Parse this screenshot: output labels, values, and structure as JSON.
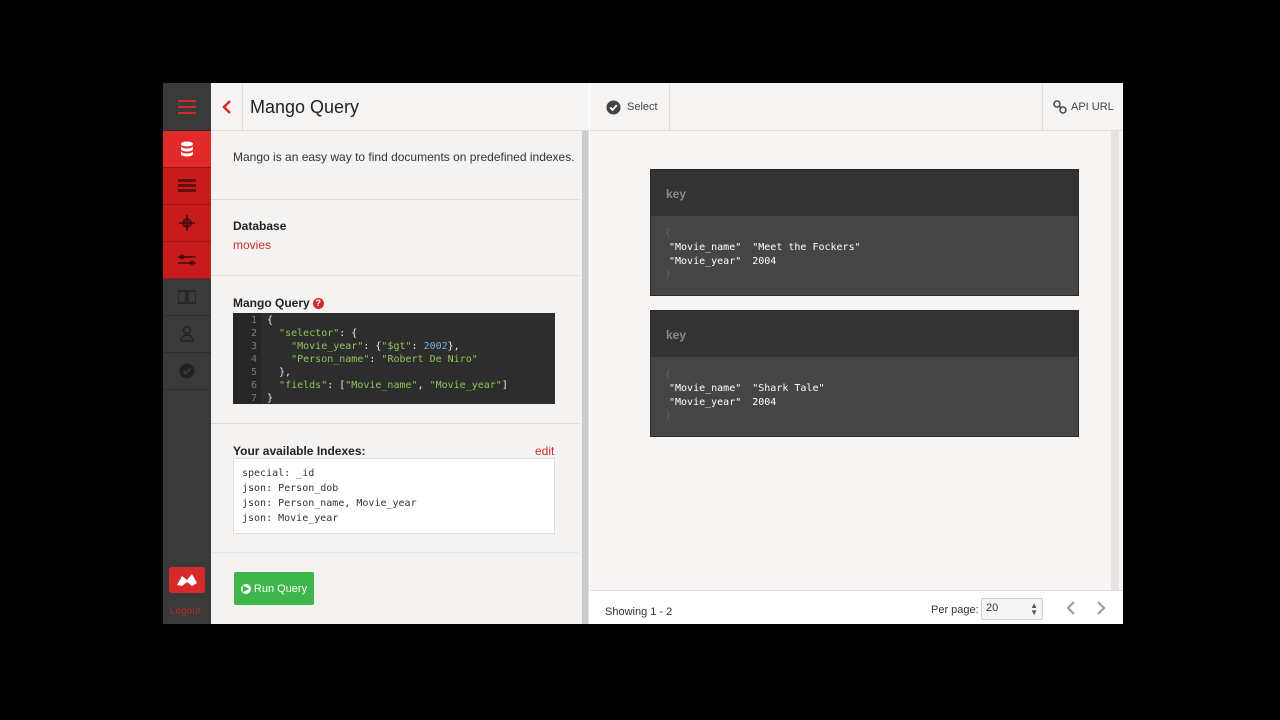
{
  "left": {
    "title": "Mango Query",
    "intro": "Mango is an easy way to find documents on predefined indexes.",
    "database_label": "Database",
    "database_name": "movies",
    "query_label": "Mango Query",
    "help": "?",
    "code_lines": [
      {
        "ln": "1",
        "parts": [
          {
            "c": "p",
            "t": "{"
          }
        ]
      },
      {
        "ln": "2",
        "parts": [
          {
            "c": "p",
            "t": "  "
          },
          {
            "c": "k",
            "t": "\"selector\""
          },
          {
            "c": "p",
            "t": ": {"
          }
        ]
      },
      {
        "ln": "3",
        "parts": [
          {
            "c": "p",
            "t": "    "
          },
          {
            "c": "k",
            "t": "\"Movie_year\""
          },
          {
            "c": "p",
            "t": ": {"
          },
          {
            "c": "k",
            "t": "\"$gt\""
          },
          {
            "c": "p",
            "t": ": "
          },
          {
            "c": "n",
            "t": "2002"
          },
          {
            "c": "p",
            "t": "},"
          }
        ]
      },
      {
        "ln": "4",
        "parts": [
          {
            "c": "p",
            "t": "    "
          },
          {
            "c": "k",
            "t": "\"Person_name\""
          },
          {
            "c": "p",
            "t": ": "
          },
          {
            "c": "s",
            "t": "\"Robert De Niro\""
          }
        ]
      },
      {
        "ln": "5",
        "parts": [
          {
            "c": "p",
            "t": "  },"
          }
        ]
      },
      {
        "ln": "6",
        "parts": [
          {
            "c": "p",
            "t": "  "
          },
          {
            "c": "k",
            "t": "\"fields\""
          },
          {
            "c": "p",
            "t": ": ["
          },
          {
            "c": "s",
            "t": "\"Movie_name\""
          },
          {
            "c": "p",
            "t": ", "
          },
          {
            "c": "s",
            "t": "\"Movie_year\""
          },
          {
            "c": "p",
            "t": "]"
          }
        ]
      },
      {
        "ln": "7",
        "parts": [
          {
            "c": "p",
            "t": "}"
          }
        ]
      }
    ],
    "indexes_label": "Your available Indexes:",
    "indexes_edit": "edit",
    "indexes": [
      "special: _id",
      "json: Person_dob",
      "json: Person_name, Movie_year",
      "json: Movie_year"
    ],
    "run_button": "Run Query"
  },
  "nav": {
    "logout": "Logout"
  },
  "right": {
    "select_label": "Select",
    "api_label": "API URL",
    "documents": [
      {
        "key": "key",
        "field1": "\"Movie_name\"",
        "value1": "\"Meet the Fockers\"",
        "field2": "\"Movie_year\"",
        "value2": "2004"
      },
      {
        "key": "key",
        "field1": "\"Movie_name\"",
        "value1": "\"Shark Tale\"",
        "field2": "\"Movie_year\"",
        "value2": "2004"
      }
    ],
    "showing": "Showing 1 - 2",
    "per_page_label": "Per page:",
    "per_page_value": "20"
  },
  "colors": {
    "accent": "#d22b2b",
    "run_button": "#3fb64b",
    "nav_dark": "#3a3a3a"
  }
}
